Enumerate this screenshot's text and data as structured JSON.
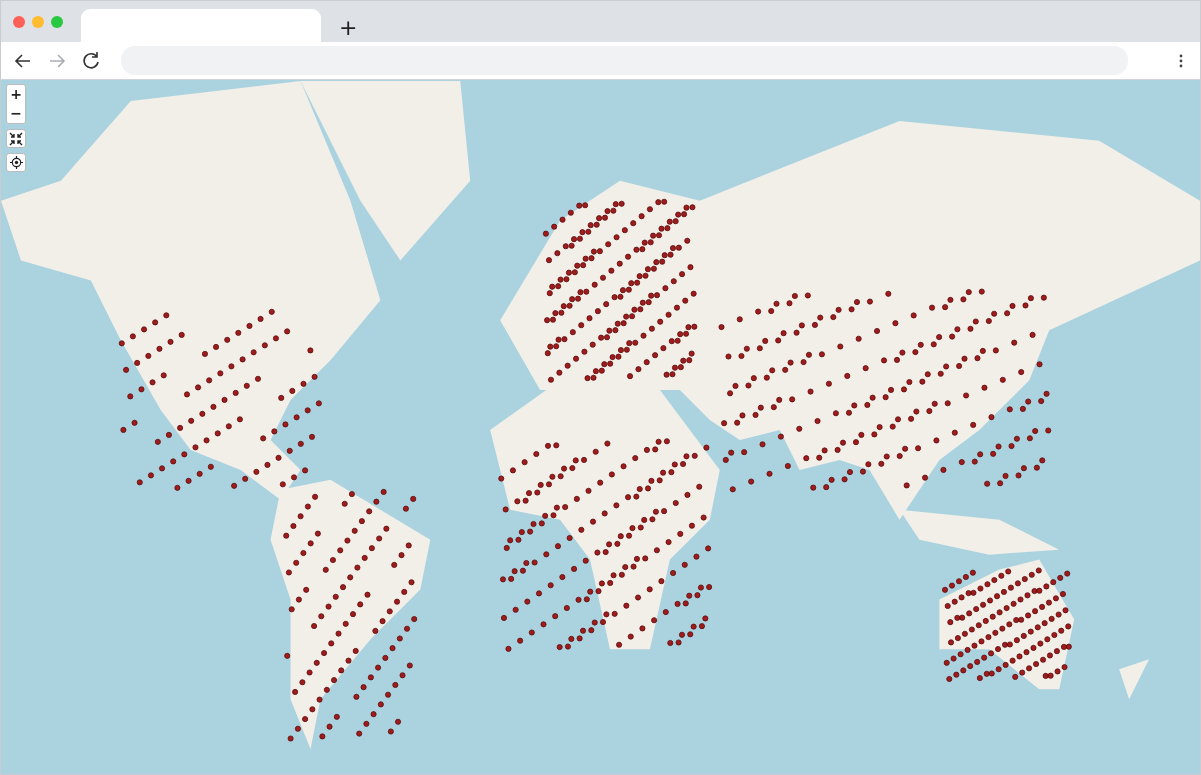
{
  "browser": {
    "tabs": [
      {
        "selected": true
      }
    ],
    "new_tab": "+",
    "forward": {
      "disabled": true
    }
  },
  "map": {
    "kind": "picture",
    "controls": {
      "zoom_in": "+",
      "zoom_out": "−"
    }
  }
}
